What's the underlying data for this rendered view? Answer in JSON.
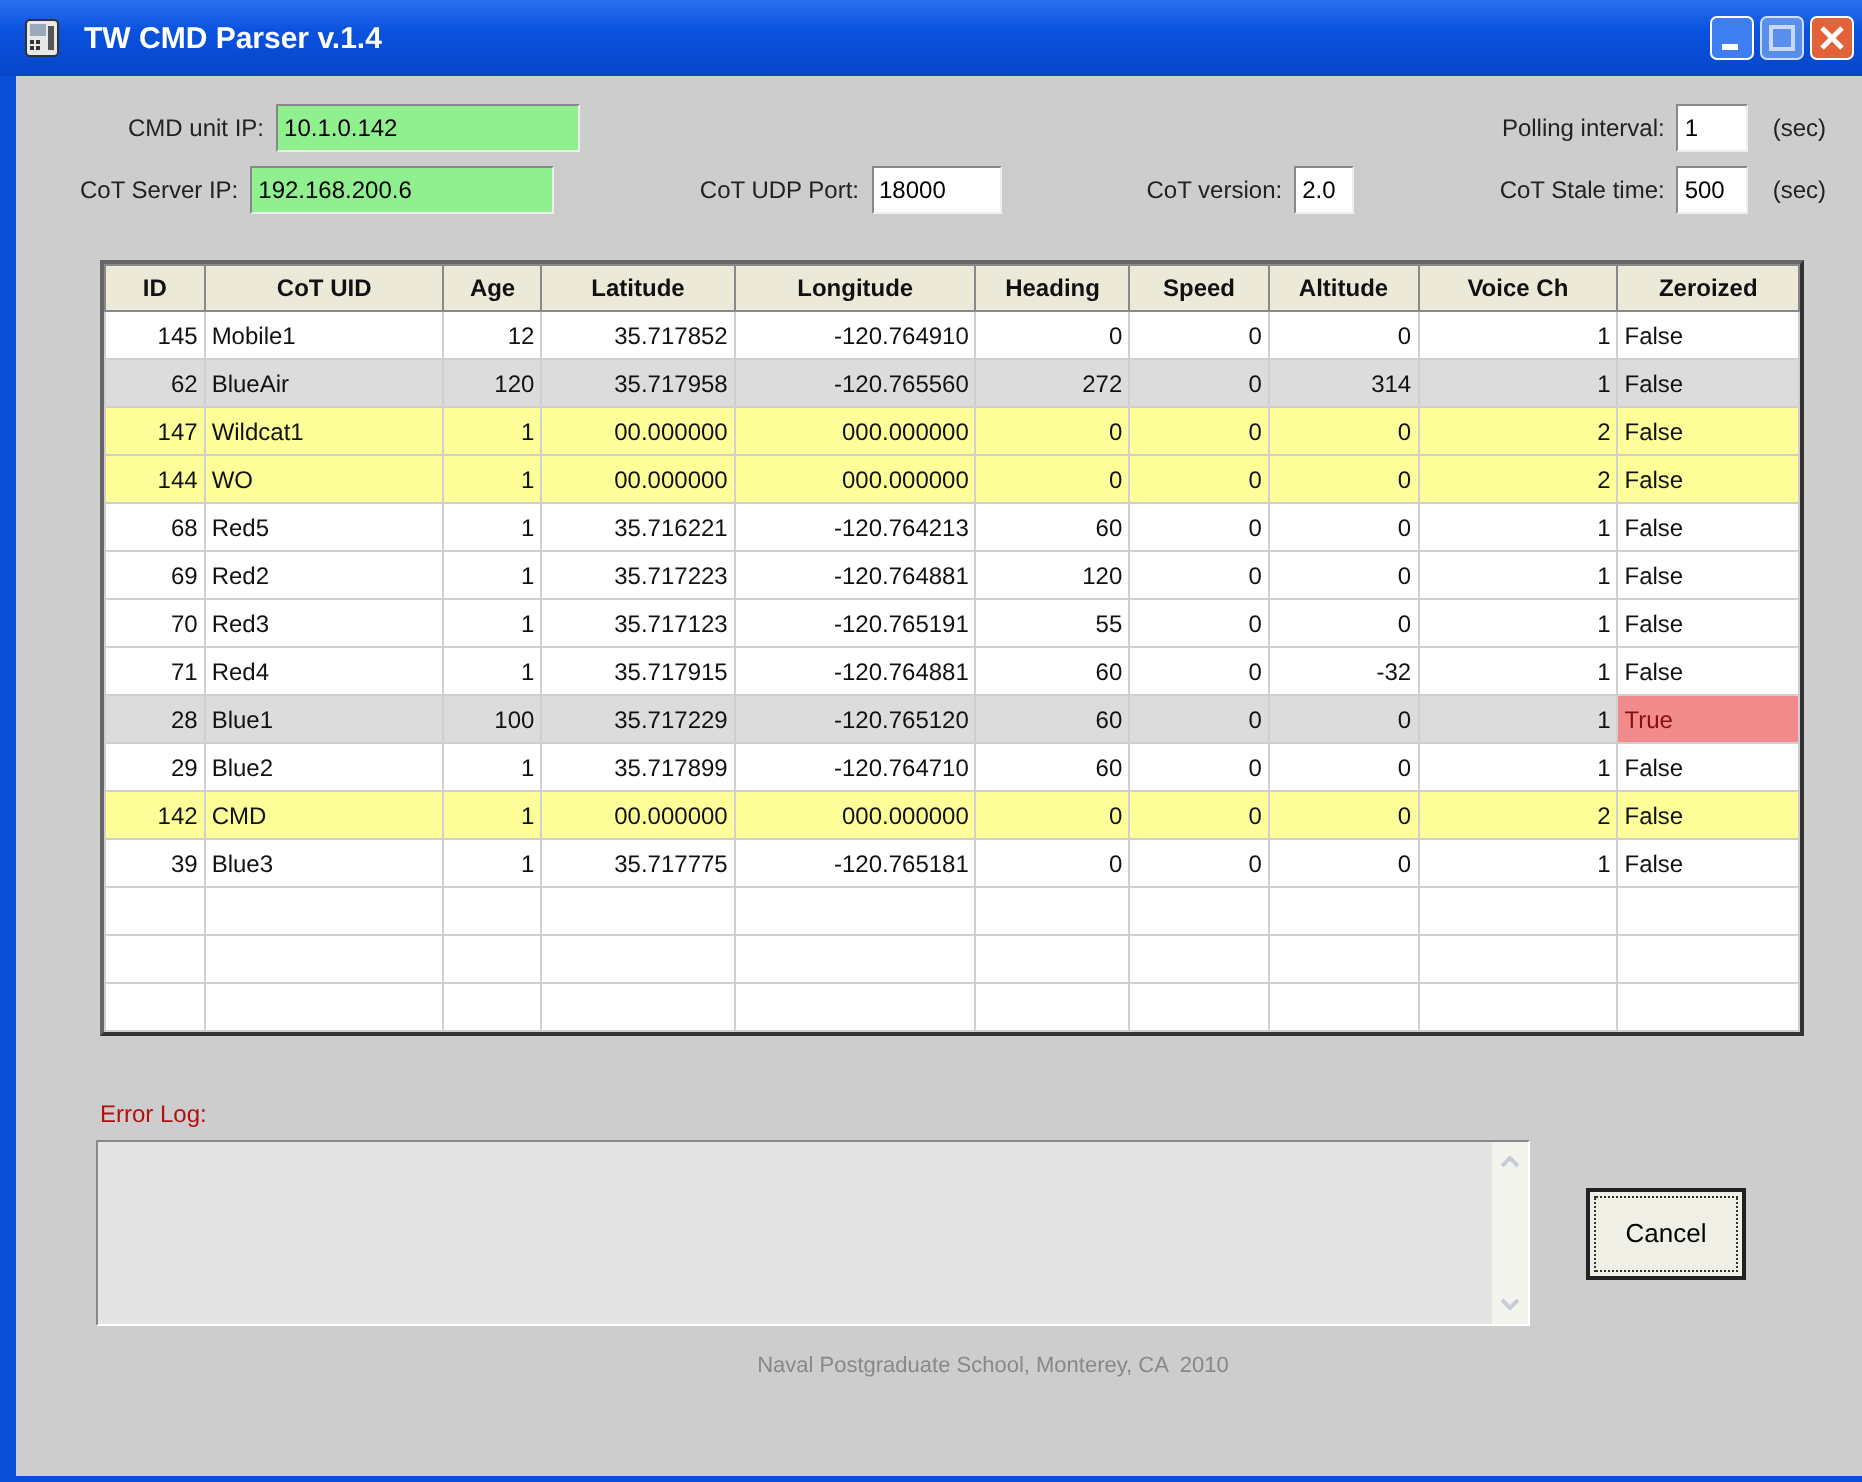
{
  "window": {
    "title": "TW CMD Parser  v.1.4"
  },
  "settings": {
    "cmd_unit_ip": {
      "label": "CMD unit IP:",
      "value": "10.1.0.142"
    },
    "polling_interval": {
      "label": "Polling interval:",
      "value": "1",
      "unit": "(sec)"
    },
    "cot_server_ip": {
      "label": "CoT Server IP:",
      "value": "192.168.200.6"
    },
    "cot_udp_port": {
      "label": "CoT UDP Port:",
      "value": "18000"
    },
    "cot_version": {
      "label": "CoT version:",
      "value": "2.0"
    },
    "cot_stale_time": {
      "label": "CoT Stale time:",
      "value": "500",
      "unit": "(sec)"
    }
  },
  "table": {
    "columns": [
      "ID",
      "CoT UID",
      "Age",
      "Latitude",
      "Longitude",
      "Heading",
      "Speed",
      "Altitude",
      "Voice Ch",
      "Zeroized"
    ],
    "rows": [
      {
        "cells": [
          "145",
          "Mobile1",
          "12",
          "35.717852",
          "-120.764910",
          "0",
          "0",
          "0",
          "1",
          "False"
        ],
        "color": "#ffffff",
        "flagged": false
      },
      {
        "cells": [
          "62",
          "BlueAir",
          "120",
          "35.717958",
          "-120.765560",
          "272",
          "0",
          "314",
          "1",
          "False"
        ],
        "color": "#dcdcdc",
        "flagged": false
      },
      {
        "cells": [
          "147",
          "Wildcat1",
          "1",
          "00.000000",
          "000.000000",
          "0",
          "0",
          "0",
          "2",
          "False"
        ],
        "color": "#ffff99",
        "flagged": false
      },
      {
        "cells": [
          "144",
          "WO",
          "1",
          "00.000000",
          "000.000000",
          "0",
          "0",
          "0",
          "2",
          "False"
        ],
        "color": "#ffff99",
        "flagged": false
      },
      {
        "cells": [
          "68",
          "Red5",
          "1",
          "35.716221",
          "-120.764213",
          "60",
          "0",
          "0",
          "1",
          "False"
        ],
        "color": "#ffffff",
        "flagged": false
      },
      {
        "cells": [
          "69",
          "Red2",
          "1",
          "35.717223",
          "-120.764881",
          "120",
          "0",
          "0",
          "1",
          "False"
        ],
        "color": "#ffffff",
        "flagged": false
      },
      {
        "cells": [
          "70",
          "Red3",
          "1",
          "35.717123",
          "-120.765191",
          "55",
          "0",
          "0",
          "1",
          "False"
        ],
        "color": "#ffffff",
        "flagged": false
      },
      {
        "cells": [
          "71",
          "Red4",
          "1",
          "35.717915",
          "-120.764881",
          "60",
          "0",
          "-32",
          "1",
          "False"
        ],
        "color": "#ffffff",
        "flagged": false
      },
      {
        "cells": [
          "28",
          "Blue1",
          "100",
          "35.717229",
          "-120.765120",
          "60",
          "0",
          "0",
          "1",
          "True"
        ],
        "color": "#dcdcdc",
        "flagged": true
      },
      {
        "cells": [
          "29",
          "Blue2",
          "1",
          "35.717899",
          "-120.764710",
          "60",
          "0",
          "0",
          "1",
          "False"
        ],
        "color": "#ffffff",
        "flagged": false
      },
      {
        "cells": [
          "142",
          "CMD",
          "1",
          "00.000000",
          "000.000000",
          "0",
          "0",
          "0",
          "2",
          "False"
        ],
        "color": "#ffff99",
        "flagged": false
      },
      {
        "cells": [
          "39",
          "Blue3",
          "1",
          "35.717775",
          "-120.765181",
          "0",
          "0",
          "0",
          "1",
          "False"
        ],
        "color": "#ffffff",
        "flagged": false
      }
    ]
  },
  "error_log": {
    "label": "Error Log:"
  },
  "buttons": [
    "Cancel"
  ],
  "footer": "Naval Postgraduate School, Monterey, CA  2010"
}
